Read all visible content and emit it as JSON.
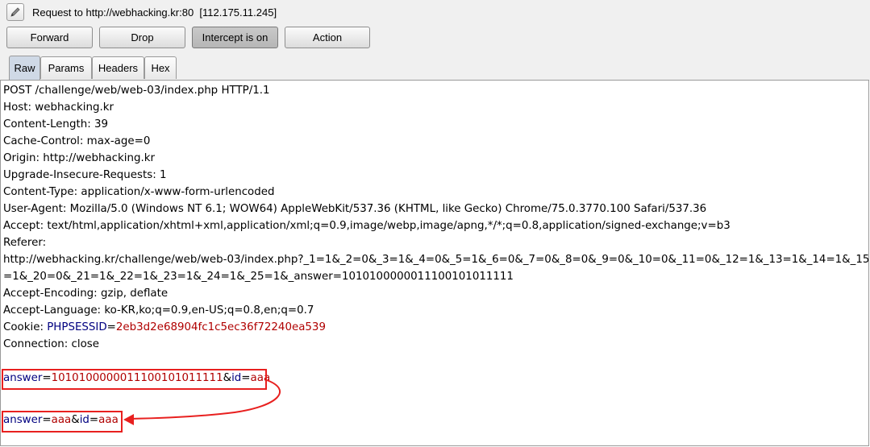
{
  "window": {
    "title": "Request to http://webhacking.kr:80  [112.175.11.245]"
  },
  "toolbar": {
    "forward": "Forward",
    "drop": "Drop",
    "intercept": "Intercept is on",
    "action": "Action"
  },
  "tabs": [
    "Raw",
    "Params",
    "Headers",
    "Hex"
  ],
  "request": {
    "lines": [
      "POST /challenge/web/web-03/index.php HTTP/1.1",
      "Host: webhacking.kr",
      "Content-Length: 39",
      "Cache-Control: max-age=0",
      "Origin: http://webhacking.kr",
      "Upgrade-Insecure-Requests: 1",
      "Content-Type: application/x-www-form-urlencoded",
      "User-Agent: Mozilla/5.0 (Windows NT 6.1; WOW64) AppleWebKit/537.36 (KHTML, like Gecko) Chrome/75.0.3770.100 Safari/537.36",
      "Accept: text/html,application/xhtml+xml,application/xml;q=0.9,image/webp,image/apng,*/*;q=0.8,application/signed-exchange;v=b3",
      "Referer:",
      "http://webhacking.kr/challenge/web/web-03/index.php?_1=1&_2=0&_3=1&_4=0&_5=1&_6=0&_7=0&_8=0&_9=0&_10=0&_11=0&_12=1&_13=1&_14=1&_15",
      "=1&_20=0&_21=1&_22=1&_23=1&_24=1&_25=1&_answer=1010100000011100101011111",
      "Accept-Encoding: gzip, deflate",
      "Accept-Language: ko-KR,ko;q=0.9,en-US;q=0.8,en;q=0.7"
    ],
    "cookie": {
      "prefix": "Cookie: ",
      "name": "PHPSESSID",
      "eq": "=",
      "value": "2eb3d2e68904fc1c5ec36f72240ea539"
    },
    "connection": "Connection: close",
    "body_original": {
      "k1": "answer",
      "eq1": "=",
      "v1": "1010100000011100101011111",
      "amp": "&",
      "k2": "id",
      "eq2": "=",
      "v2": "aaa"
    },
    "body_modified": {
      "k1": "answer",
      "eq1": "=",
      "v1": "aaa",
      "amp": "&",
      "k2": "id",
      "eq2": "=",
      "v2": "aaa"
    }
  },
  "colors": {
    "param_name": "#000080",
    "param_value": "#b00000",
    "highlight": "#e8201f"
  }
}
